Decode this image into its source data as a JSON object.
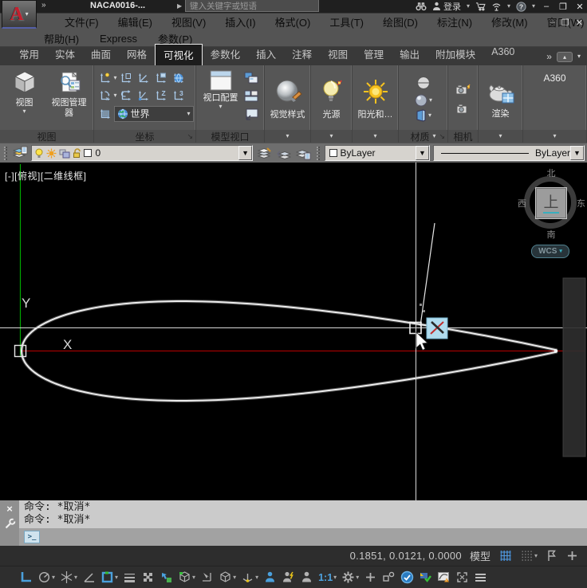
{
  "title_bar": {
    "logo_letter": "A",
    "overflow": "»",
    "doc_title": "NACA0016-...",
    "flyout": "▶",
    "search_placeholder": "键入关键字或短语",
    "sign_in_label": "登录",
    "window_buttons": {
      "minimize": "–",
      "maximize": "❐",
      "close": "✕"
    }
  },
  "menu_bar": {
    "row1": [
      "文件(F)",
      "编辑(E)",
      "视图(V)",
      "插入(I)",
      "格式(O)",
      "工具(T)",
      "绘图(D)",
      "标注(N)",
      "修改(M)",
      "窗口(W)"
    ],
    "row2": [
      "帮助(H)",
      "Express",
      "参数(P)"
    ],
    "doc_window_buttons": {
      "minimize": "–",
      "restore": "❐",
      "close": "✕"
    }
  },
  "ribbon": {
    "tabs": [
      "常用",
      "实体",
      "曲面",
      "网格",
      "可视化",
      "参数化",
      "插入",
      "注释",
      "视图",
      "管理",
      "输出",
      "附加模块",
      "A360"
    ],
    "active_tab_index": 4,
    "overflow": "»",
    "minimize_glyph": "▴",
    "panels": {
      "view": {
        "caption": "视图",
        "view_btn": "视图",
        "view_manager_btn": "视图管理器"
      },
      "coordinates": {
        "caption": "坐标",
        "world_dropdown_value": "世界",
        "icons_row1": [
          "ucs-icon",
          "ucs-object-icon",
          "ucs-origin-icon",
          "ucs-face-icon",
          "ucs-world-icon"
        ],
        "icons_row2": [
          "ucs-x-rotate-icon",
          "ucs-previous-icon",
          "ucs-zaxis-icon",
          "ucs-z-icon",
          "ucs-3point-icon"
        ],
        "icon_row3": "ucs-view-icon"
      },
      "model_viewports": {
        "caption": "模型视口",
        "viewport_config_btn": "视口配置"
      },
      "visual_styles": {
        "label": "视觉样式"
      },
      "lights": {
        "label": "光源"
      },
      "sun": {
        "label": "阳光和…"
      },
      "materials": {
        "caption": "材质"
      },
      "camera": {
        "caption": "相机"
      },
      "render": {
        "label": "渲染"
      },
      "a360": {
        "label": "A360"
      }
    }
  },
  "layers_toolbar": {
    "layer_name": "0",
    "color_value": "ByLayer",
    "linetype_value": "ByLayer"
  },
  "canvas": {
    "viewport_label": "[-][俯视][二维线框]",
    "viewcube": {
      "north": "北",
      "south": "南",
      "west": "西",
      "east": "东",
      "top_face": "上",
      "wcs": "WCS"
    },
    "axis_labels": {
      "x": "X",
      "y": "Y"
    }
  },
  "command_line": {
    "history": [
      "命令: *取消*",
      "命令: *取消*"
    ],
    "prompt_glyph": ">_"
  },
  "status_bar": {
    "coordinates": "0.1851, 0.0121, 0.0000",
    "model_label": "模型",
    "scale_label": "1:1",
    "icons_row1": [
      {
        "name": "grid-display-icon",
        "kind": "grid",
        "active": true
      },
      {
        "name": "snap-mode-icon",
        "kind": "snapdots",
        "dd": true
      },
      {
        "name": "annotation-flag-icon",
        "kind": "flag"
      },
      {
        "name": "add-icon",
        "kind": "plus"
      }
    ],
    "icons_row2": [
      {
        "name": "ortho-mode-icon",
        "kind": "ortho",
        "active": true
      },
      {
        "name": "polar-tracking-icon",
        "kind": "polar",
        "dd": true
      },
      {
        "name": "isometric-drafting-icon",
        "kind": "iso",
        "dd": true
      },
      {
        "name": "object-snap-tracking-icon",
        "kind": "angle"
      },
      {
        "name": "object-snap-icon",
        "kind": "osnap",
        "active": true,
        "dd": true
      },
      {
        "name": "lineweight-icon",
        "kind": "lw"
      },
      {
        "name": "transparency-icon",
        "kind": "checker"
      },
      {
        "name": "selection-cycling-icon",
        "kind": "selcycle"
      },
      {
        "name": "dynamic-ucs-icon",
        "kind": "cube",
        "dd": true
      },
      {
        "name": "dynamic-input-icon",
        "kind": "dyninput"
      },
      {
        "name": "selection-filter-icon",
        "kind": "cube2",
        "dd": true
      },
      {
        "name": "gizmo-icon",
        "kind": "gizmo",
        "dd": true
      },
      {
        "name": "annotation-visibility-icon",
        "kind": "person",
        "active": true
      },
      {
        "name": "annotation-autoscale-icon",
        "kind": "person2"
      },
      {
        "name": "annotation-scale-icon",
        "kind": "person3"
      },
      {
        "name": "annotation-scale-value",
        "kind": "text",
        "label": "1:1",
        "dd": true
      },
      {
        "name": "workspace-switching-icon",
        "kind": "gear",
        "dd": true
      },
      {
        "name": "annotation-monitor-icon",
        "kind": "plus"
      },
      {
        "name": "isolate-objects-icon",
        "kind": "isolate"
      },
      {
        "name": "hardware-acceleration-icon",
        "kind": "hwaccel",
        "active": true
      },
      {
        "name": "plot-icon",
        "kind": "plot"
      },
      {
        "name": "graphics-performance-icon",
        "kind": "perf"
      },
      {
        "name": "clean-screen-icon",
        "kind": "cleanscreen"
      },
      {
        "name": "customization-icon",
        "kind": "menu"
      }
    ]
  },
  "colors": {
    "accent_blue": "#4aa0dc",
    "canvas_bg": "#000000",
    "crosshair": "#dcdcdc",
    "x_axis_red": "#b40000",
    "y_axis_green": "#00a800",
    "snap_badge_bg": "#b0dcee"
  }
}
